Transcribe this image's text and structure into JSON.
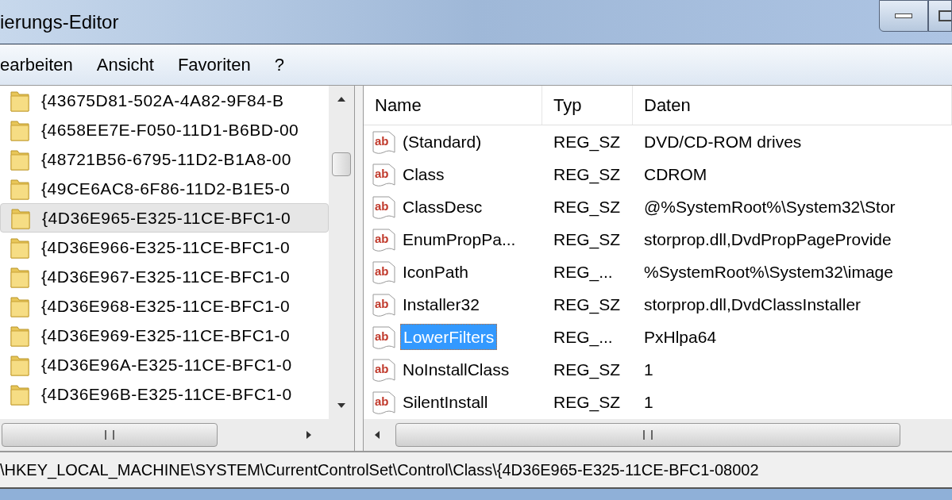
{
  "window": {
    "title": "ierungs-Editor"
  },
  "menu": [
    "earbeiten",
    "Ansicht",
    "Favoriten",
    "?"
  ],
  "tree": {
    "items": [
      {
        "label": "{43675D81-502A-4A82-9F84-B",
        "selected": false
      },
      {
        "label": "{4658EE7E-F050-11D1-B6BD-00",
        "selected": false
      },
      {
        "label": "{48721B56-6795-11D2-B1A8-00",
        "selected": false
      },
      {
        "label": "{49CE6AC8-6F86-11D2-B1E5-0",
        "selected": false
      },
      {
        "label": "{4D36E965-E325-11CE-BFC1-0",
        "selected": true
      },
      {
        "label": "{4D36E966-E325-11CE-BFC1-0",
        "selected": false
      },
      {
        "label": "{4D36E967-E325-11CE-BFC1-0",
        "selected": false
      },
      {
        "label": "{4D36E968-E325-11CE-BFC1-0",
        "selected": false
      },
      {
        "label": "{4D36E969-E325-11CE-BFC1-0",
        "selected": false
      },
      {
        "label": "{4D36E96A-E325-11CE-BFC1-0",
        "selected": false
      },
      {
        "label": "{4D36E96B-E325-11CE-BFC1-0",
        "selected": false
      }
    ]
  },
  "table": {
    "columns": [
      "Name",
      "Typ",
      "Daten"
    ],
    "rows": [
      {
        "icon_text": "ab",
        "name": "(Standard)",
        "type": "REG_SZ",
        "data": "DVD/CD-ROM drives",
        "selected": false
      },
      {
        "icon_text": "ab",
        "name": "Class",
        "type": "REG_SZ",
        "data": "CDROM",
        "selected": false
      },
      {
        "icon_text": "ab",
        "name": "ClassDesc",
        "type": "REG_SZ",
        "data": "@%SystemRoot%\\System32\\Stor",
        "selected": false
      },
      {
        "icon_text": "ab",
        "name": "EnumPropPa...",
        "type": "REG_SZ",
        "data": "storprop.dll,DvdPropPageProvide",
        "selected": false
      },
      {
        "icon_text": "ab",
        "name": "IconPath",
        "type": "REG_...",
        "data": "%SystemRoot%\\System32\\image",
        "selected": false
      },
      {
        "icon_text": "ab",
        "name": "Installer32",
        "type": "REG_SZ",
        "data": "storprop.dll,DvdClassInstaller",
        "selected": false
      },
      {
        "icon_text": "ab",
        "name": "LowerFilters",
        "type": "REG_...",
        "data": "PxHlpa64",
        "selected": true
      },
      {
        "icon_text": "ab",
        "name": "NoInstallClass",
        "type": "REG_SZ",
        "data": "1",
        "selected": false
      },
      {
        "icon_text": "ab",
        "name": "SilentInstall",
        "type": "REG_SZ",
        "data": "1",
        "selected": false
      }
    ]
  },
  "status_bar": "\\HKEY_LOCAL_MACHINE\\SYSTEM\\CurrentControlSet\\Control\\Class\\{4D36E965-E325-11CE-BFC1-08002"
}
